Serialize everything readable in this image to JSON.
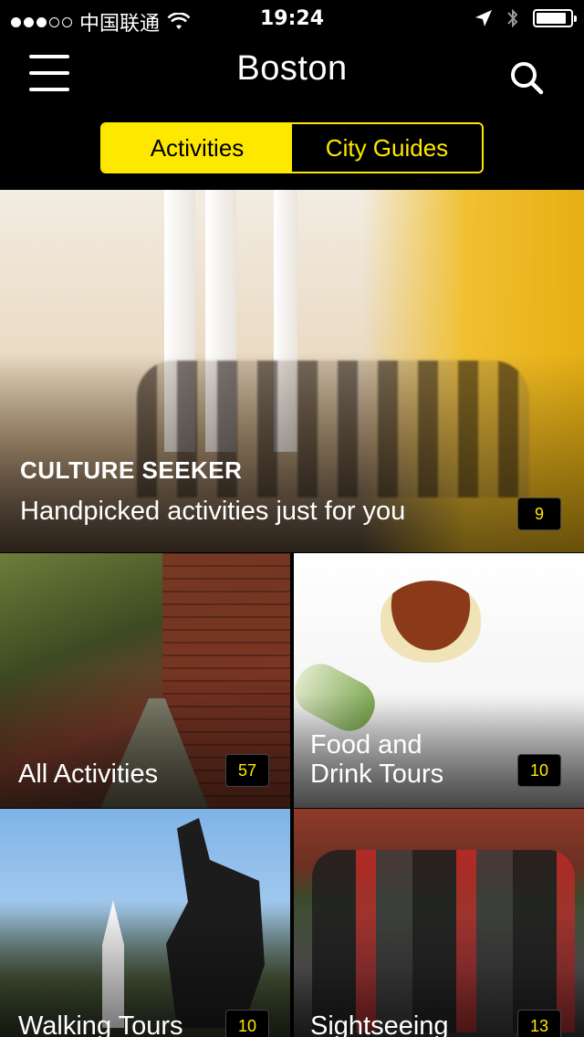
{
  "status_bar": {
    "carrier": "中国联通",
    "time": "19:24"
  },
  "nav": {
    "title": "Boston"
  },
  "segments": {
    "activities": "Activities",
    "city_guides": "City Guides"
  },
  "hero": {
    "heading": "CULTURE SEEKER",
    "subtitle": "Handpicked activities just for you",
    "count": "9"
  },
  "tiles": [
    {
      "title": "All Activities",
      "count": "57"
    },
    {
      "title_line1": "Food and",
      "title_line2": "Drink Tours",
      "count": "10"
    },
    {
      "title": "Walking Tours",
      "count": "10"
    },
    {
      "title": "Sightseeing",
      "count": "13"
    }
  ],
  "colors": {
    "accent": "#ffe800",
    "background": "#000000"
  }
}
